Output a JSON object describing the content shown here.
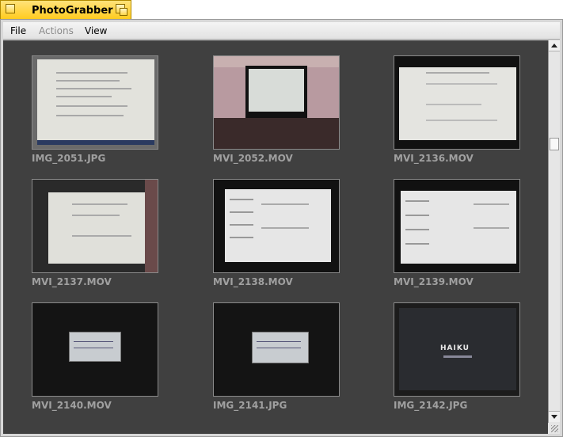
{
  "window": {
    "title": "PhotoGrabber"
  },
  "menu": [
    {
      "label": "File",
      "enabled": true
    },
    {
      "label": "Actions",
      "enabled": false
    },
    {
      "label": "View",
      "enabled": true
    }
  ],
  "colors": {
    "tab": "#ffcb1f",
    "content_bg": "#404040",
    "caption": "#a0a0a0"
  },
  "items": [
    {
      "name": "IMG_2051.JPG"
    },
    {
      "name": "MVI_2052.MOV"
    },
    {
      "name": "MVI_2136.MOV"
    },
    {
      "name": "MVI_2137.MOV"
    },
    {
      "name": "MVI_2138.MOV"
    },
    {
      "name": "MVI_2139.MOV"
    },
    {
      "name": "MVI_2140.MOV"
    },
    {
      "name": "IMG_2141.JPG"
    },
    {
      "name": "IMG_2142.JPG"
    }
  ],
  "splash_text": "HAIKU"
}
